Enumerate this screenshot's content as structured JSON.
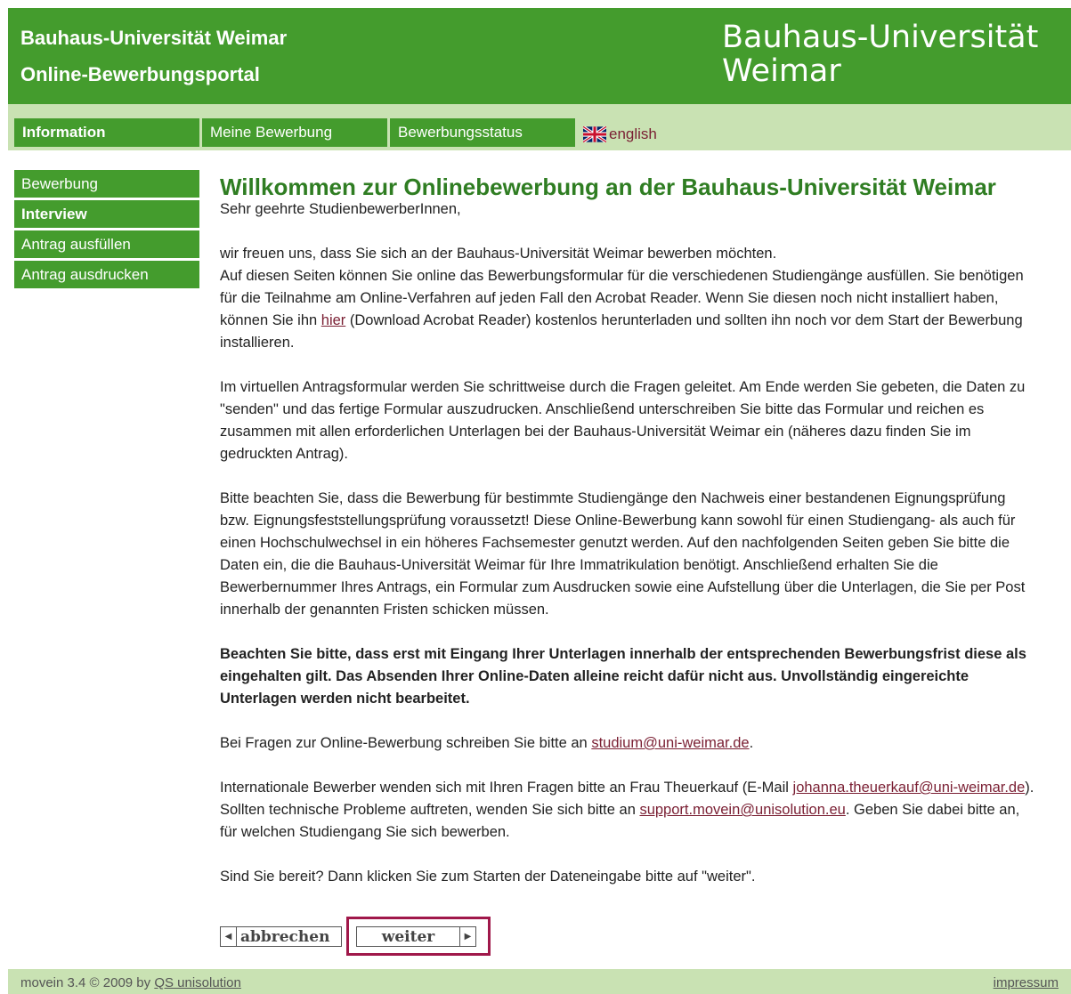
{
  "header": {
    "line1": "Bauhaus-Universität Weimar",
    "line2": "Online-Bewerbungsportal",
    "logo_line1": "Bauhaus-Universität",
    "logo_line2": "Weimar"
  },
  "nav": {
    "tabs": [
      {
        "label": "Information"
      },
      {
        "label": "Meine Bewerbung"
      },
      {
        "label": "Bewerbungsstatus"
      }
    ],
    "language": "english",
    "language_icon": "uk-flag-icon"
  },
  "sidebar": {
    "items": [
      {
        "label": "Bewerbung"
      },
      {
        "label": "Interview"
      },
      {
        "label": "Antrag ausfüllen"
      },
      {
        "label": "Antrag ausdrucken"
      }
    ]
  },
  "main": {
    "title": "Willkommen zur Onlinebewerbung an der Bauhaus-Universität Weimar",
    "greeting": "Sehr geehrte StudienbewerberInnen,",
    "p1_a": "wir freuen uns, dass Sie sich an der Bauhaus-Universität Weimar bewerben möchten.",
    "p1_b": "Auf diesen Seiten können Sie online das Bewerbungsformular für die verschiedenen Studiengänge ausfüllen. Sie benötigen für die Teilnahme am Online-Verfahren auf jeden Fall den Acrobat Reader. Wenn Sie diesen noch nicht installiert haben, können Sie ihn ",
    "p1_link": "hier",
    "p1_c": " (Download Acrobat Reader) kostenlos herunterladen und sollten ihn noch vor dem Start der Bewerbung installieren.",
    "p2": "Im virtuellen Antragsformular werden Sie schrittweise durch die Fragen geleitet. Am Ende werden Sie gebeten, die Daten zu \"senden\" und das fertige Formular auszudrucken. Anschließend unterschreiben Sie bitte das Formular und reichen es zusammen mit allen erforderlichen Unterlagen bei der Bauhaus-Universität Weimar ein (näheres dazu finden Sie im gedruckten Antrag).",
    "p3": "Bitte beachten Sie, dass die Bewerbung für bestimmte Studiengänge den Nachweis einer bestandenen Eignungsprüfung bzw. Eignungsfeststellungsprüfung voraussetzt! Diese Online-Bewerbung kann sowohl für einen Studiengang- als auch für einen Hochschulwechsel in ein höheres Fachsemester genutzt werden. Auf den nachfolgenden Seiten geben Sie bitte die Daten ein, die die Bauhaus-Universität Weimar für Ihre Immatrikulation benötigt. Anschließend erhalten Sie die Bewerbernummer Ihres Antrags, ein Formular zum Ausdrucken sowie eine Aufstellung über die Unterlagen, die Sie per Post innerhalb der genannten Fristen schicken müssen.",
    "p4_bold": "Beachten Sie bitte, dass erst mit Eingang Ihrer Unterlagen innerhalb der entsprechenden Bewerbungsfrist diese als eingehalten gilt. Das Absenden Ihrer Online-Daten alleine reicht dafür nicht aus. Unvollständig eingereichte Unterlagen werden nicht bearbeitet.",
    "p5_a": "Bei Fragen zur Online-Bewerbung schreiben Sie bitte an ",
    "p5_link": "studium@uni-weimar.de",
    "p5_b": ".",
    "p6_a": "Internationale Bewerber wenden sich mit Ihren Fragen bitte an Frau Theuerkauf (E-Mail ",
    "p6_link1": "johanna.theuerkauf@uni-weimar.de",
    "p6_b": "). Sollten technische Probleme auftreten, wenden Sie sich bitte an ",
    "p6_link2": "support.movein@unisolution.eu",
    "p6_c": ". Geben Sie dabei bitte an, für welchen Studiengang Sie sich bewerben.",
    "p7": "Sind Sie bereit? Dann klicken Sie zum Starten der Dateneingabe bitte auf \"weiter\"."
  },
  "buttons": {
    "cancel_label": "abbrechen",
    "next_label": "weiter"
  },
  "footer": {
    "left_prefix": "movein 3.4 © 2009 by ",
    "left_link": "QS unisolution",
    "right_link": "impressum"
  },
  "colors": {
    "brand_green": "#449c2d",
    "light_green": "#c9e2b3",
    "title_green": "#2f7d22",
    "link_color": "#7a1f33",
    "highlight": "#a0184a"
  }
}
